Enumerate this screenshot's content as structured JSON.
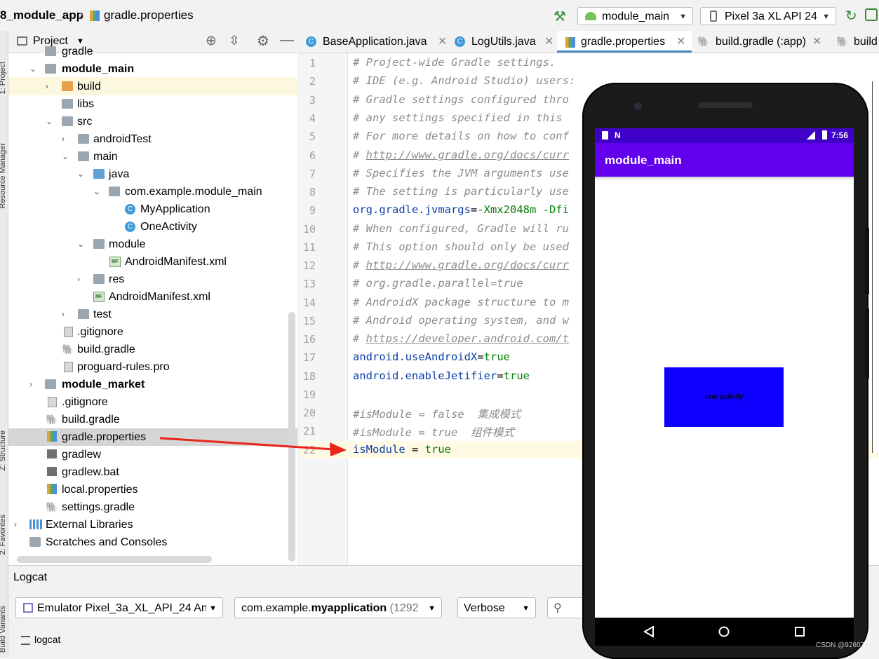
{
  "toolbar": {
    "project": "8_module_app",
    "file": "gradle.properties",
    "config": "module_main",
    "device": "Pixel 3a XL API 24"
  },
  "left_stripe": {
    "project": "1: Project",
    "resource": "Resource Manager",
    "structure": "Z: Structure",
    "favorites": "2: Favorites",
    "variants": "Build Variants"
  },
  "project_panel": {
    "title": "Project",
    "items": [
      {
        "label": "gradle",
        "bold": false
      },
      {
        "label": "module_main",
        "bold": true
      },
      {
        "label": "build",
        "bold": false
      },
      {
        "label": "libs",
        "bold": false
      },
      {
        "label": "src",
        "bold": false
      },
      {
        "label": "androidTest",
        "bold": false
      },
      {
        "label": "main",
        "bold": false
      },
      {
        "label": "java",
        "bold": false
      },
      {
        "label": "com.example.module_main",
        "bold": false
      },
      {
        "label": "MyApplication",
        "bold": false
      },
      {
        "label": "OneActivity",
        "bold": false
      },
      {
        "label": "module",
        "bold": false
      },
      {
        "label": "AndroidManifest.xml",
        "bold": false
      },
      {
        "label": "res",
        "bold": false
      },
      {
        "label": "AndroidManifest.xml",
        "bold": false
      },
      {
        "label": "test",
        "bold": false
      },
      {
        "label": ".gitignore",
        "bold": false
      },
      {
        "label": "build.gradle",
        "bold": false
      },
      {
        "label": "proguard-rules.pro",
        "bold": false
      },
      {
        "label": "module_market",
        "bold": true
      },
      {
        "label": ".gitignore",
        "bold": false
      },
      {
        "label": "build.gradle",
        "bold": false
      },
      {
        "label": "gradle.properties",
        "bold": false
      },
      {
        "label": "gradlew",
        "bold": false
      },
      {
        "label": "gradlew.bat",
        "bold": false
      },
      {
        "label": "local.properties",
        "bold": false
      },
      {
        "label": "settings.gradle",
        "bold": false
      },
      {
        "label": "External Libraries",
        "bold": false
      },
      {
        "label": "Scratches and Consoles",
        "bold": false
      }
    ]
  },
  "tabs": [
    {
      "label": "BaseApplication.java"
    },
    {
      "label": "LogUtils.java"
    },
    {
      "label": "gradle.properties"
    },
    {
      "label": "build.gradle (:app)"
    },
    {
      "label": "build"
    }
  ],
  "code": {
    "line_numbers": [
      "1",
      "2",
      "3",
      "4",
      "5",
      "6",
      "7",
      "8",
      "9",
      "10",
      "11",
      "12",
      "13",
      "14",
      "15",
      "16",
      "17",
      "18",
      "19",
      "20",
      "21",
      "22"
    ],
    "l1": "# Project-wide Gradle settings.",
    "l2": "# IDE (e.g. Android Studio) users:",
    "l3": "# Gradle settings configured thro",
    "l4": "# any settings specified in this",
    "l5": "# For more details on how to conf",
    "l6_prefix": "# ",
    "l6_link": "http://www.gradle.org/docs/curr",
    "l7": "# Specifies the JVM arguments use",
    "l8": "# The setting is particularly use",
    "l9_key": "org.gradle.jvmargs",
    "l9_val": "-Xmx2048m -Dfi",
    "l10": "# When configured, Gradle will ru",
    "l11": "# This option should only be used",
    "l12_prefix": "# ",
    "l12_link": "http://www.gradle.org/docs/curr",
    "l13": "# org.gradle.parallel=true",
    "l14": "# AndroidX package structure to m",
    "l15": "# Android operating system, and w",
    "l16_prefix": "# ",
    "l16_link": "https://developer.android.com/t",
    "l17_key": "android.useAndroidX",
    "l17_val": "true",
    "l18_key": "android.enableJetifier",
    "l18_val": "true",
    "l20": "#isModule = false  集成模式",
    "l21": "#isModule = true  组件模式",
    "l22_key": "isModule",
    "l22_eq": " = ",
    "l22_val": "true"
  },
  "logcat": {
    "title": "Logcat",
    "device": "Emulator Pixel_3a_XL_API_24 Anc",
    "package_prefix": "com.example.",
    "package_bold": "myapplication",
    "package_suffix": " (1292",
    "level": "Verbose",
    "tab": "logcat"
  },
  "phone": {
    "time": "7:56",
    "app_title": "module_main",
    "button_text": "one activity",
    "colors": {
      "status": "#3f00c8",
      "appbar": "#6200ee",
      "box": "#0d00ff"
    }
  },
  "watermark": "CSDN @92607",
  "colors": {
    "arrow": "#e8261c",
    "selection": "#d5d5d5",
    "caret_line": "#fffae3"
  }
}
